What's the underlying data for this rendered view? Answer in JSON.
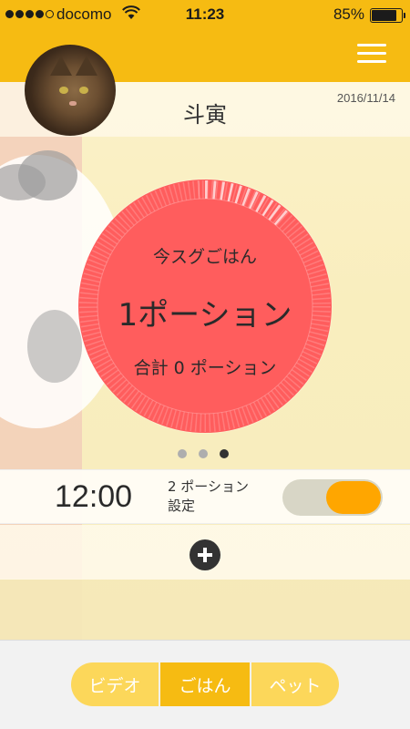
{
  "status_bar": {
    "carrier": "docomo",
    "time": "11:23",
    "battery": "85%"
  },
  "header": {
    "menu_icon": "hamburger-menu-icon",
    "pet_name": "斗寅",
    "date": "2016/11/14"
  },
  "dial": {
    "prompt": "今スグごはん",
    "portion": "1ポーション",
    "total": "合計 0 ポーション"
  },
  "pager": {
    "count": 3,
    "active_index": 2
  },
  "schedule": {
    "time": "12:00",
    "portion": "2 ポーション",
    "setting": "設定",
    "enabled": true
  },
  "add_icon": "plus-circle-icon",
  "tabs": {
    "video": "ビデオ",
    "food": "ごはん",
    "pet": "ペット",
    "active": "ごはん"
  },
  "colors": {
    "header": "#f6bb12",
    "dial": "#ff5d5d",
    "toggle_on": "#ffa600",
    "tab_inactive": "#fcd75a",
    "tab_active": "#f6bb12"
  }
}
